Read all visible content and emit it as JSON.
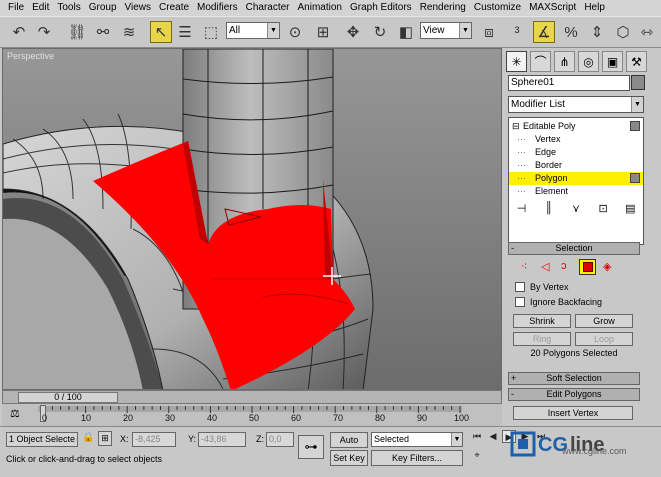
{
  "menu": [
    "File",
    "Edit",
    "Tools",
    "Group",
    "Views",
    "Create",
    "Modifiers",
    "Character",
    "Animation",
    "Graph Editors",
    "Rendering",
    "Customize",
    "MAXScript",
    "Help"
  ],
  "toolbar": {
    "selection_filter": "All",
    "coord_system": "View"
  },
  "viewport": {
    "label": "Perspective"
  },
  "command_panel": {
    "object_name": "Sphere01",
    "modifier_list": "Modifier List",
    "stack": [
      {
        "label": "Editable Poly",
        "prefix": "⊟"
      },
      {
        "label": "Vertex",
        "prefix": "···"
      },
      {
        "label": "Edge",
        "prefix": "···"
      },
      {
        "label": "Border",
        "prefix": "···"
      },
      {
        "label": "Polygon",
        "prefix": "···"
      },
      {
        "label": "Element",
        "prefix": "···"
      }
    ],
    "selection": {
      "title": "Selection",
      "by_vertex": "By Vertex",
      "ignore_backfacing": "Ignore Backfacing",
      "shrink": "Shrink",
      "grow": "Grow",
      "ring": "Ring",
      "loop": "Loop",
      "status": "20 Polygons Selected"
    },
    "soft_selection": "Soft Selection",
    "edit_polygons": "Edit Polygons",
    "insert_vertex": "Insert Vertex"
  },
  "timeline": {
    "frame": "0 / 100",
    "ticks": [
      "0",
      "10",
      "20",
      "30",
      "40",
      "50",
      "60",
      "70",
      "80",
      "90",
      "100"
    ]
  },
  "status": {
    "objects": "1 Object Selecte",
    "x_label": "X:",
    "x_value": "-8,425",
    "y_label": "Y:",
    "y_value": "-43,86",
    "z_label": "Z:",
    "z_value": "0,0",
    "prompt": "Click or click-and-drag to select objects",
    "auto_key": "Auto Key",
    "set_key": "Set Key",
    "key_mode": "Selected",
    "key_filters": "Key Filters...",
    "watermark": "www.cgline.com"
  },
  "colors": {
    "selection_red": "#ff0000",
    "active_yellow": "#ffef00"
  }
}
